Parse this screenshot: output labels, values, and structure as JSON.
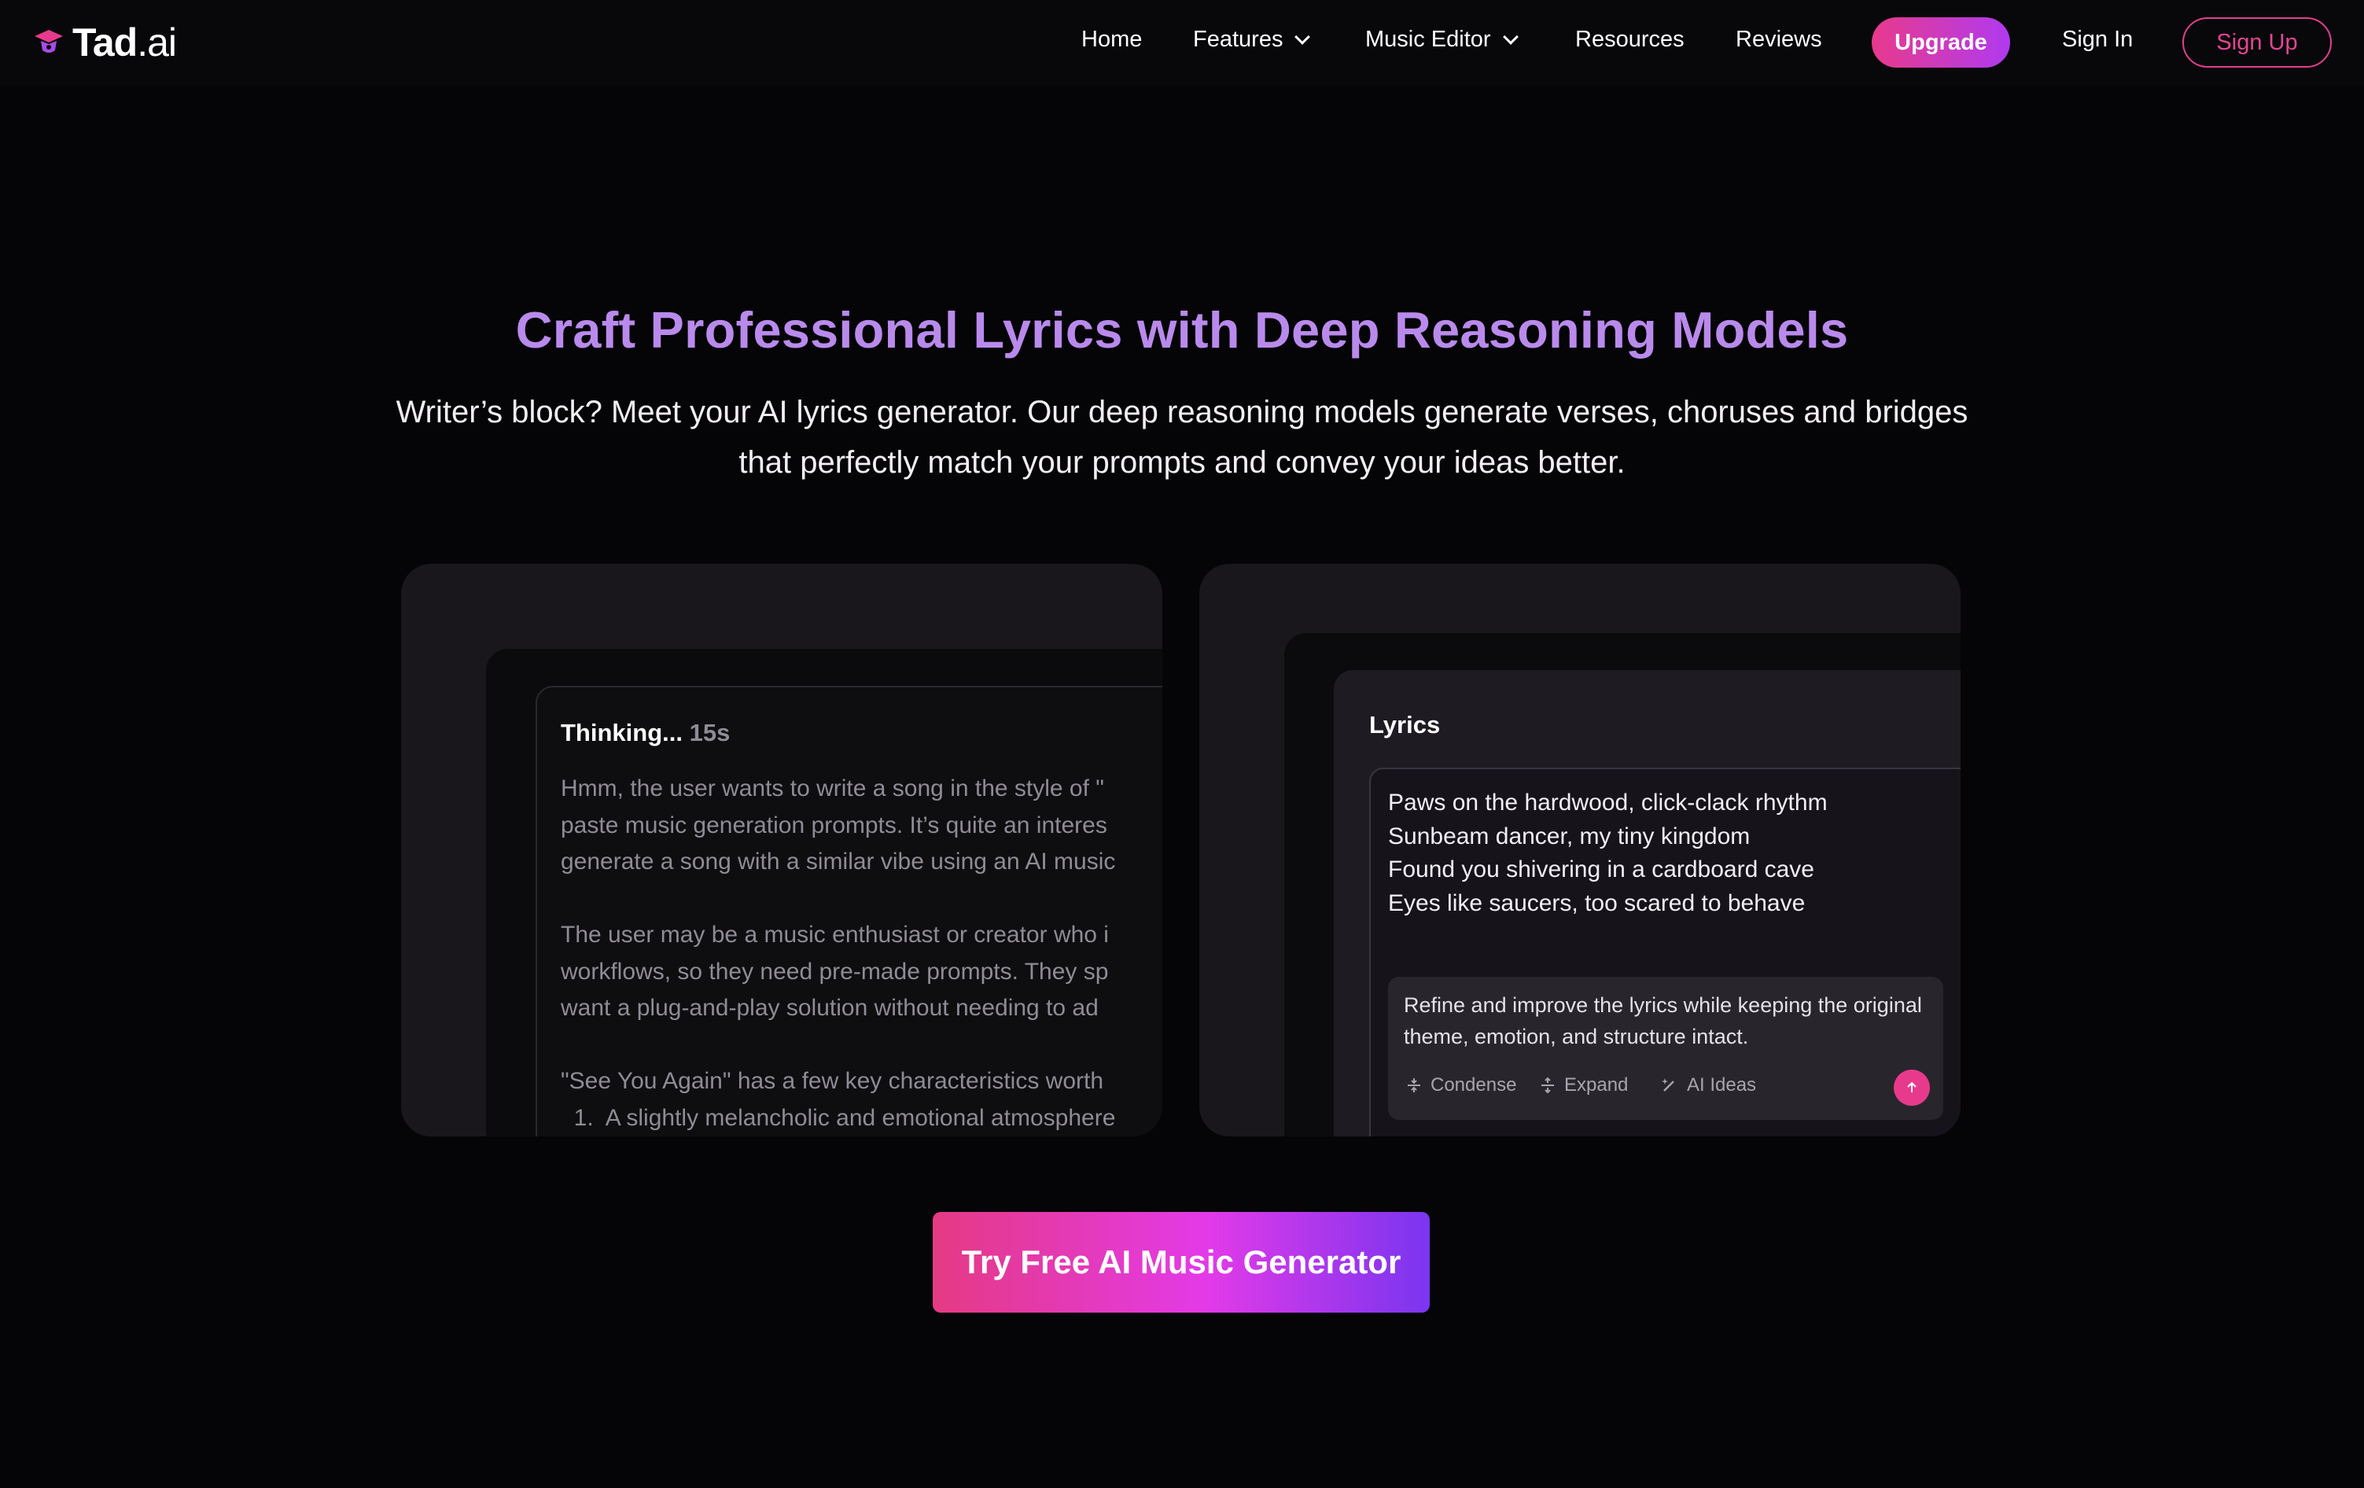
{
  "brand": {
    "name": "Tad",
    "suffix": ".ai"
  },
  "nav": {
    "links": [
      "Home",
      "Features",
      "Music Editor",
      "Resources",
      "Reviews"
    ],
    "upgrade": "Upgrade",
    "sign_in": "Sign In",
    "sign_up": "Sign Up"
  },
  "hero": {
    "title": "Craft Professional Lyrics with Deep Reasoning Models",
    "subtitle": "Writer’s block? Meet your AI lyrics generator. Our deep reasoning models generate verses, choruses and bridges that perfectly match your prompts and convey your ideas better."
  },
  "thinking": {
    "label": "Thinking...",
    "seconds": "15s",
    "text": "Hmm, the user wants to write a song in the style of \"\npaste music generation prompts. It’s quite an interes\ngenerate a song with a similar vibe using an AI music\n\nThe user may be a music enthusiast or creator who i\nworkflows, so they need pre-made prompts. They sp\nwant a plug-and-play solution without needing to ad\n\n\"See You Again\" has a few key characteristics worth\n  1.  A slightly melancholic and emotional atmosphere"
  },
  "lyrics": {
    "label": "Lyrics",
    "text": "Paws on the hardwood, click-clack rhythm\nSunbeam dancer, my tiny kingdom\nFound you shivering in a cardboard cave\nEyes like saucers, too scared to behave",
    "refine_prompt": "Refine and improve the lyrics while keeping the original theme, emotion, and structure intact.",
    "tools": [
      "Condense",
      "Expand",
      "AI Ideas"
    ]
  },
  "cta": {
    "label": "Try Free AI Music Generator"
  },
  "colors": {
    "background": "#050407",
    "title": "#b98aec",
    "accent_pink": "#e83a8c",
    "accent_purple": "#7a35f0"
  }
}
